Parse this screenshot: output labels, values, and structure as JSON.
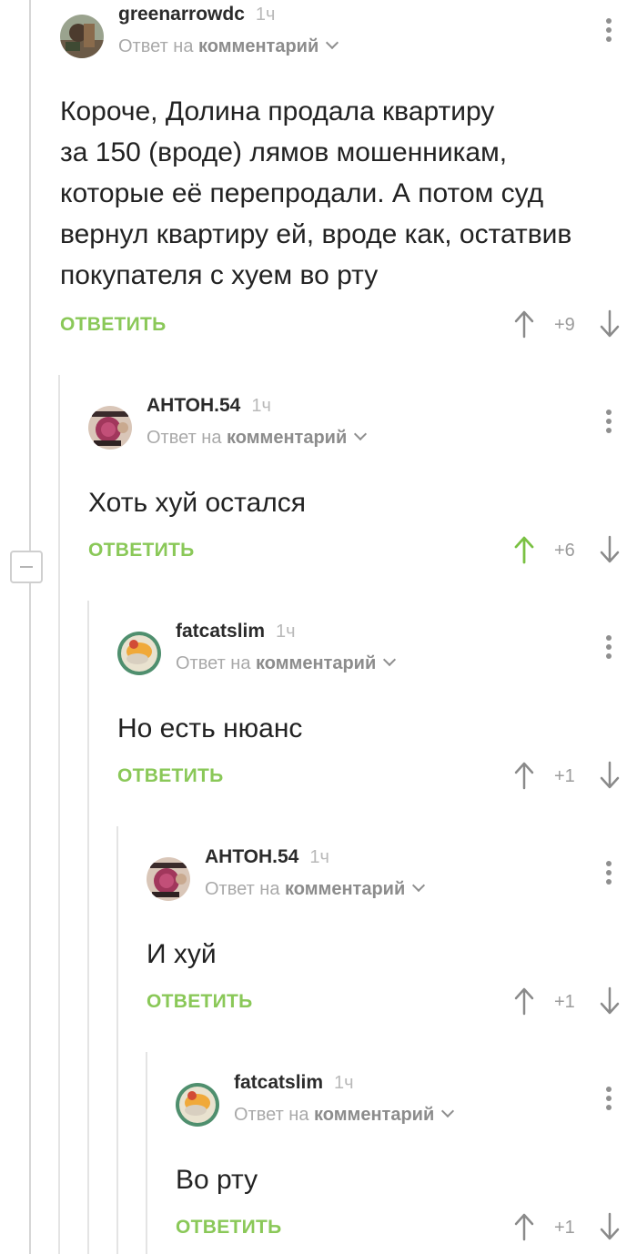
{
  "comments": [
    {
      "author": "greenarrowdc",
      "time": "1ч",
      "reply_prefix": "Ответ на",
      "reply_target": "комментарий",
      "text_lines": [
        "Короче, Долина продала квартиру",
        "за 150 (вроде) лямов мошенникам,",
        "которые её перепродали. А потом суд",
        "вернул квартиру ей, вроде как, остатвив",
        "покупателя с хуем во рту"
      ],
      "reply_label": "ОТВЕТИТЬ",
      "score": "+9",
      "upvoted": false
    },
    {
      "author": "АНТОН.54",
      "time": "1ч",
      "reply_prefix": "Ответ на",
      "reply_target": "комментарий",
      "text_lines": [
        "Хоть хуй остался"
      ],
      "reply_label": "ОТВЕТИТЬ",
      "score": "+6",
      "upvoted": true
    },
    {
      "author": "fatcatslim",
      "time": "1ч",
      "reply_prefix": "Ответ на",
      "reply_target": "комментарий",
      "text_lines": [
        "Но есть нюанс"
      ],
      "reply_label": "ОТВЕТИТЬ",
      "score": "+1",
      "upvoted": false
    },
    {
      "author": "АНТОН.54",
      "time": "1ч",
      "reply_prefix": "Ответ на",
      "reply_target": "комментарий",
      "text_lines": [
        "И хуй"
      ],
      "reply_label": "ОТВЕТИТЬ",
      "score": "+1",
      "upvoted": false
    },
    {
      "author": "fatcatslim",
      "time": "1ч",
      "reply_prefix": "Ответ на",
      "reply_target": "комментарий",
      "text_lines": [
        "Во рту"
      ],
      "reply_label": "ОТВЕТИТЬ",
      "score": "+1",
      "upvoted": false
    }
  ],
  "colors": {
    "accent_green": "#8ac858",
    "text": "#222222",
    "muted": "#a9a9a9",
    "thread_line": "#e4e4e4"
  }
}
